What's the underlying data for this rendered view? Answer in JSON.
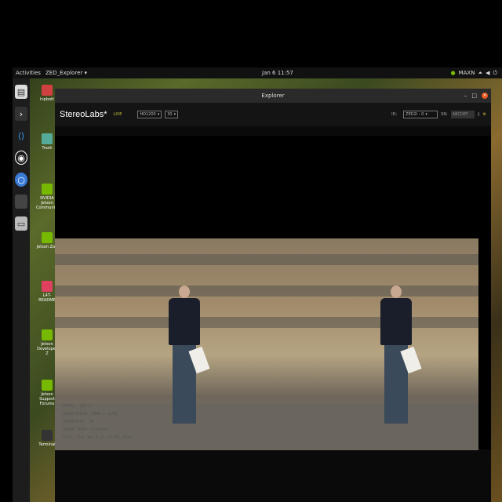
{
  "topbar": {
    "activities": "Activities",
    "app_menu": "ZED_Explorer ▾",
    "clock": "Jan 6 11:57",
    "nvidia": "MAXN"
  },
  "dock": {
    "items": [
      "files-icon",
      "terminal-icon",
      "vscode-icon",
      "obs-icon",
      "chromium-icon",
      "blank-icon",
      "drive-icon"
    ]
  },
  "desktop": {
    "items": [
      "Inpbott",
      "Trash",
      "NVIDIA Jetson Community",
      "Jetson Zoo",
      "L4T-README",
      "Jetson Developer Z",
      "Jetson Support Forums",
      "Terminal"
    ]
  },
  "window": {
    "title": "Explorer",
    "logo": "StereoLabs*",
    "live": "LIVE",
    "resolution_select": "HD1200",
    "fps_select": "30",
    "id_label": "ID:",
    "camera_select": "ZED2i - 0",
    "sn_label": "SN:",
    "sn_value": "ABCDEF"
  },
  "info": {
    "model": "MODEL: ZED X",
    "resolution": "RESOLUTION: 3840 x 1200",
    "framerate": "FRAMERATE: 30",
    "frame_drop": "FRAME DROP: 0/00410",
    "date": "DATE: Thu Jan 6 11:57:38 2024"
  }
}
